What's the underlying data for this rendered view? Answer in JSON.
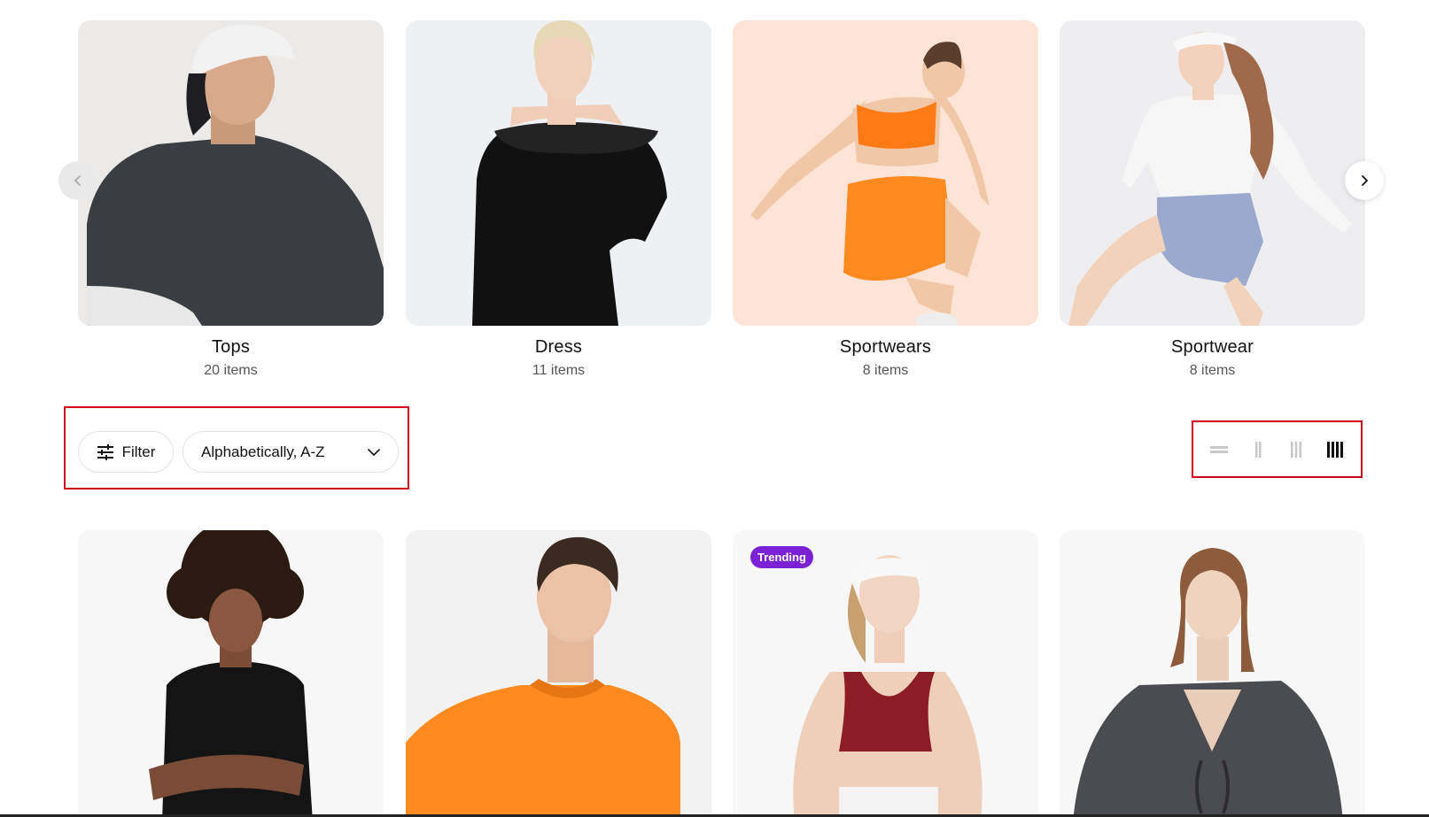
{
  "collections": [
    {
      "name": "Tops",
      "count": "20 items"
    },
    {
      "name": "Dress",
      "count": "11 items"
    },
    {
      "name": "Sportwears",
      "count": "8 items"
    },
    {
      "name": "Sportwear",
      "count": "8 items"
    }
  ],
  "carousel": {
    "prev_icon": "chevron-left-icon",
    "next_icon": "chevron-right-icon"
  },
  "toolbar": {
    "filter_label": "Filter",
    "filter_icon": "sliders-icon",
    "sort_value": "Alphabetically, A-Z",
    "sort_icon": "chevron-down-icon",
    "layout_options": [
      "list-layout",
      "2-column-layout",
      "3-column-layout",
      "4-column-layout"
    ],
    "layout_active": "4-column-layout"
  },
  "products": [
    {
      "badge": ""
    },
    {
      "badge": ""
    },
    {
      "badge": "Trending"
    },
    {
      "badge": ""
    }
  ],
  "colors": {
    "highlight": "#d0021b",
    "badge": "#7c22d6",
    "accent_orange": "#ff8a1f"
  }
}
